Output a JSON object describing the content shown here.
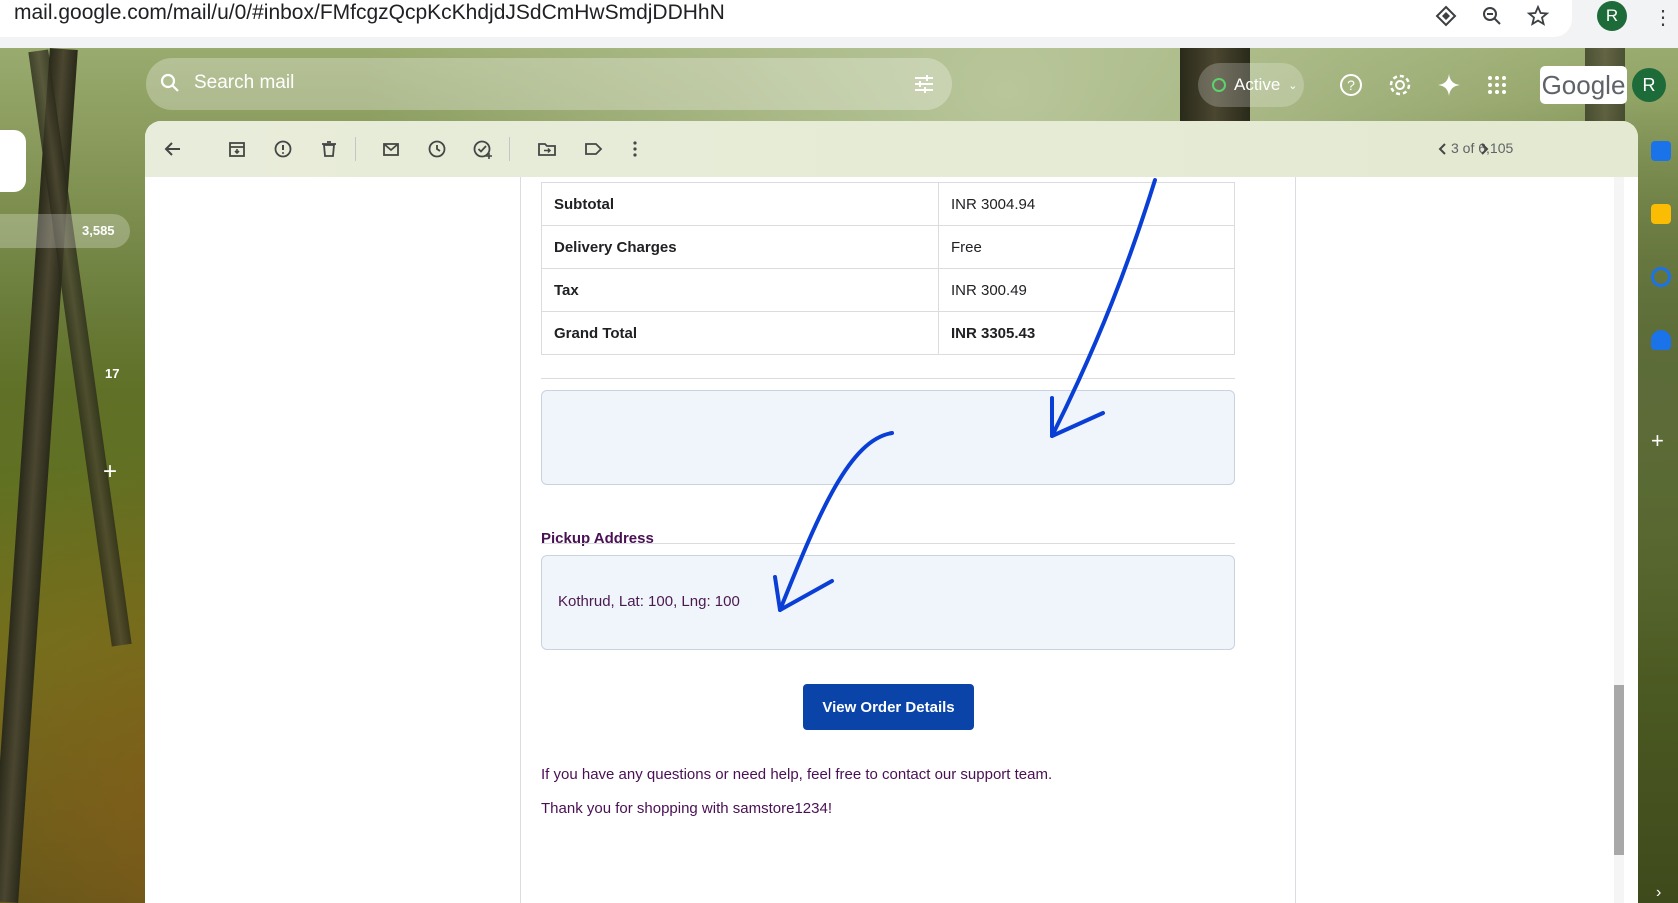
{
  "browser": {
    "url": "mail.google.com/mail/u/0/#inbox/FMfcgzQcpKcKhdjdJSdCmHwSmdjDDHhN",
    "profile_initial": "R"
  },
  "gmail": {
    "search_placeholder": "Search mail",
    "status_label": "Active",
    "brand": "Google",
    "avatar_initial": "R",
    "counts": {
      "inbox": "3,585",
      "other": "17"
    },
    "pager": "3 of 6,105"
  },
  "email": {
    "totals": [
      {
        "label": "Subtotal",
        "value": "INR 3004.94"
      },
      {
        "label": "Delivery Charges",
        "value": "Free"
      },
      {
        "label": "Tax",
        "value": "INR 300.49"
      },
      {
        "label": "Grand Total",
        "value": "INR 3305.43"
      }
    ],
    "delivery_address_text": "",
    "pickup_title": "Pickup Address",
    "pickup_address": "Kothrud, Lat: 100, Lng: 100",
    "cta_label": "View Order Details",
    "help_text": "If you have any questions or need help, feel free to contact our support team.",
    "thanks_text": "Thank you for shopping with samstore1234!"
  },
  "colors": {
    "cta_bg": "#0b44a8",
    "accent_text": "#4a1054",
    "annotation_stroke": "#0a3fd6",
    "box_bg": "#f0f4fb"
  }
}
